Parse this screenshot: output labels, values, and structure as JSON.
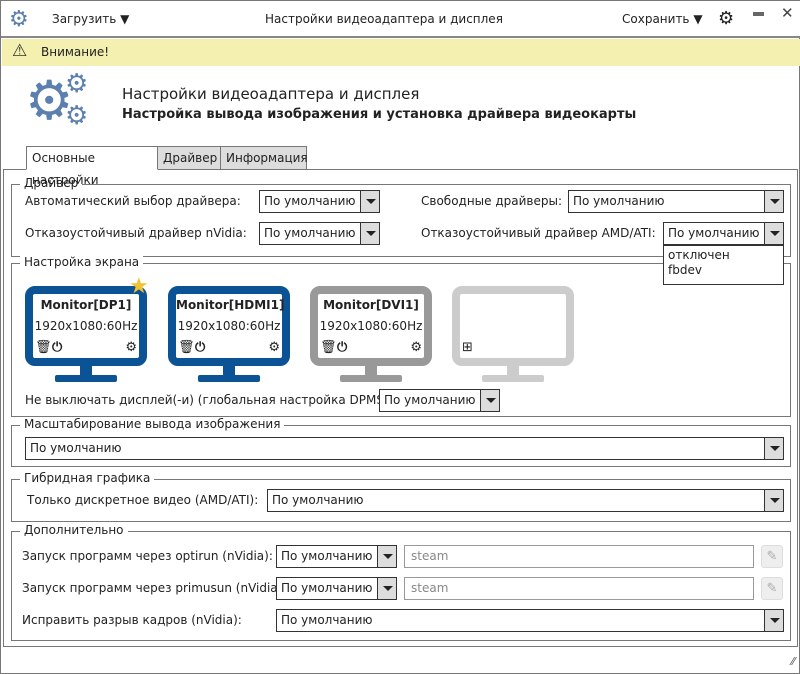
{
  "titlebar": {
    "load_label": "Загрузить",
    "title": "Настройки видеоадаптера и дисплея",
    "save_label": "Сохранить",
    "app_icon": "gears-icon",
    "settings_icon": "gear-icon",
    "minimize_icon": "minimize-icon",
    "close_icon": "close-icon"
  },
  "banner": {
    "text": "Внимание!",
    "icon": "warning-icon",
    "color": "#f3f0b0"
  },
  "header": {
    "title": "Настройки видеоадаптера и дисплея",
    "subtitle": "Настройка вывода изображения и установка драйвера видеокарты",
    "icon_color": "#5b7fae"
  },
  "tabs": [
    {
      "label": "Основные настройки",
      "active": true
    },
    {
      "label": "Драйвер"
    },
    {
      "label": "Информация"
    }
  ],
  "driver": {
    "title": "Драйвер",
    "auto_label": "Автоматический выбор драйвера:",
    "auto_value": "По умолчанию",
    "free_label": "Свободные драйверы:",
    "free_value": "По умолчанию",
    "nvidia_label": "Отказоустойчивый драйвер nVidia:",
    "nvidia_value": "По умолчанию",
    "amd_label": "Отказоустойчивый драйвер AMD/ATI:",
    "amd_value": "По умолчанию",
    "amd_options": [
      "отключен",
      "fbdev"
    ]
  },
  "screen": {
    "title": "Настройка экрана",
    "monitors": [
      {
        "name": "Monitor[DP1]",
        "resolution": "1920x1080:60Hz",
        "color": "#0b5394",
        "primary": true
      },
      {
        "name": "Monitor[HDMI1]",
        "resolution": "1920x1080:60Hz",
        "color": "#0b5394"
      },
      {
        "name": "Monitor[DVI1]",
        "resolution": "1920x1080:60Hz",
        "color": "#999999"
      },
      {
        "name": "",
        "resolution": "",
        "color": "#cccccc"
      }
    ],
    "dpms_label": "Не выключать дисплей(-и) (глобальная настройка DPMS):",
    "dpms_value": "По умолчанию"
  },
  "scaling": {
    "title": "Масштабирование вывода изображения",
    "value": "По умолчанию"
  },
  "hybrid": {
    "title": "Гибридная графика",
    "discrete_label": "Только дискретное видео (AMD/ATI):",
    "discrete_value": "По умолчанию"
  },
  "extra": {
    "title": "Дополнительно",
    "optirun_label": "Запуск программ через optirun (nVidia):",
    "optirun_value": "По умолчанию",
    "optirun_input": "steam",
    "primusun_label": "Запуск программ через primusun (nVidia):",
    "primusun_value": "По умолчанию",
    "primusun_input": "steam",
    "tearing_label": "Исправить разрыв кадров (nVidia):",
    "tearing_value": "По умолчанию"
  }
}
